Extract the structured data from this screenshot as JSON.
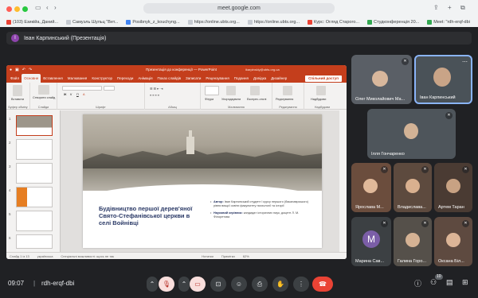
{
  "browser": {
    "url": "meet.google.com",
    "bookmarks": [
      "(103) Езикійа, Даний...",
      "Самуэль Шульц \"Вет...",
      "Posibnyk_z_kouchyng...",
      "https://online.ubts.org...",
      "https://online.ubts.org...",
      "Курс: Огляд Старого...",
      "Студконференція 20...",
      "Meet: \"rdh-erqf-dbi"
    ]
  },
  "presenter": {
    "avatar_letter": "І",
    "label": "Іван Карпинський (Презентація)"
  },
  "ppt": {
    "title": "Презентація до конференції — PowerPoint",
    "email": "ikarpinskiy@ubts.org.ua",
    "tabs": [
      "Файл",
      "Основне",
      "Вставлення",
      "Малювання",
      "Конструктор",
      "Переходи",
      "Анімація",
      "Показ слайдів",
      "Записати",
      "Рецензування",
      "Подання",
      "Довідка",
      "Дизайнер"
    ],
    "share_label": "Спільний доступ",
    "ribbon_groups": [
      "Буфер обміну",
      "Слайди",
      "Шрифт",
      "Абзац",
      "Малювання",
      "Редагування",
      "Надбудови"
    ],
    "ribbon_labels": {
      "paste": "Вставити",
      "new_slide": "Створити слайд",
      "shapes": "Фігури",
      "arrange": "Упорядкувати",
      "styles": "Експрес-стилі",
      "editing": "Редагування",
      "addins": "Надбудови"
    },
    "thumb_numbers": [
      "1",
      "2",
      "3",
      "4",
      "5",
      "6"
    ],
    "slide": {
      "title": "Будівництво першої дерев'яної Свято-Стефанівської церкви в селі Войнівці",
      "author_label": "Автор:",
      "author_text": "Іван Карпинський студент І курсу першого (бакалаврського) рівня вищої освіти факультету психології та історії",
      "advisor_label": "Науковий керівник:",
      "advisor_text": "кандидат історичних наук, доцент Л. М. Філоретова"
    },
    "status": {
      "slide_of": "Слайд 1 із 13",
      "lang": "українська",
      "accessibility": "Спеціальні можливості: щось не так",
      "notes": "Нотатки",
      "comments": "Примітки",
      "zoom": "62%"
    }
  },
  "participants": [
    {
      "name": "Олег Миколайович Ма...",
      "muted": true
    },
    {
      "name": "Іван Карпинський",
      "muted": false
    },
    {
      "name": "Ілля Гончаренко",
      "muted": true
    },
    {
      "name": "Ярослава М...",
      "muted": true
    },
    {
      "name": "Владиславa...",
      "muted": true
    },
    {
      "name": "Артем Таран",
      "muted": true
    },
    {
      "name": "Марина Сав...",
      "muted": true,
      "avatar_letter": "М"
    },
    {
      "name": "Галина Горо...",
      "muted": true
    },
    {
      "name": "Оксана Біл...",
      "muted": true
    }
  ],
  "bottom_bar": {
    "time": "09:07",
    "separator": "|",
    "meeting_code": "rdh-erqf-dbi",
    "participant_count": "10"
  },
  "colors": {
    "ppt_accent": "#c43e1c",
    "meet_bg": "#202124",
    "end_call": "#ea4335",
    "muted_button": "#f9dedc",
    "slide_title": "#2b3a67"
  }
}
